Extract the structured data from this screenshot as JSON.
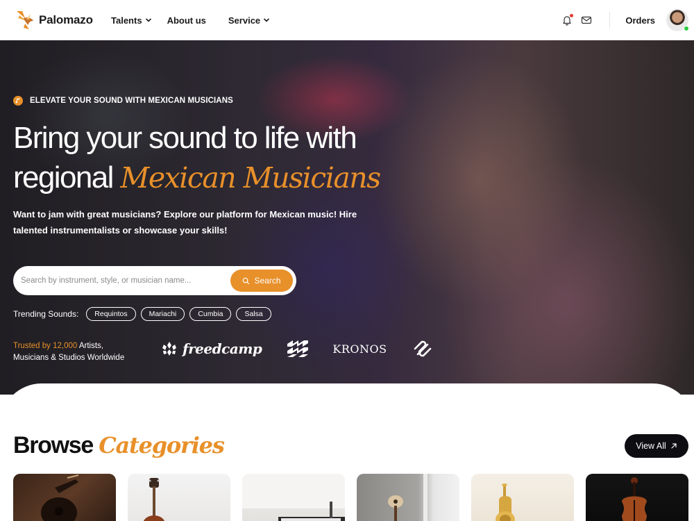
{
  "nav": {
    "brand": "Palomazo",
    "links": [
      {
        "label": "Talents",
        "dropdown": true
      },
      {
        "label": "About us",
        "dropdown": false
      },
      {
        "label": "Service",
        "dropdown": true
      }
    ],
    "orders_label": "Orders"
  },
  "hero": {
    "eyebrow": "ELEVATE YOUR SOUND WITH MEXICAN MUSICIANS",
    "headline_line1": "Bring your sound to life with",
    "headline_line2_plain": "regional",
    "headline_line2_accent": "Mexican Musicians",
    "subtext": "Want to jam with great musicians? Explore our platform for Mexican music! Hire talented instrumentalists or showcase your skills!",
    "search": {
      "placeholder": "Search by instrument, style, or musician name...",
      "button_label": "Search"
    },
    "trending_label": "Trending Sounds:",
    "trending": [
      "Requintos",
      "Mariachi",
      "Cumbia",
      "Salsa"
    ],
    "trust_prefix": "Trusted by 12,000",
    "trust_suffix": "Artists,",
    "trust_line2": "Musicians & Studios Worldwide",
    "partner_logos": [
      "freedcamp",
      "KRONOS"
    ]
  },
  "browse": {
    "title_plain": "Browse",
    "title_accent": "Categories",
    "view_all": "View All"
  },
  "colors": {
    "accent": "#e8902a",
    "dark_button": "#0d0d12",
    "notification_dot": "#e53935",
    "online": "#2ecc40"
  },
  "icons": {
    "logo": "bird-logo-icon",
    "bell": "bell-icon",
    "mail": "mail-icon",
    "search": "search-icon",
    "arrow": "arrow-up-right-icon",
    "eyebrow": "music-note-icon"
  }
}
